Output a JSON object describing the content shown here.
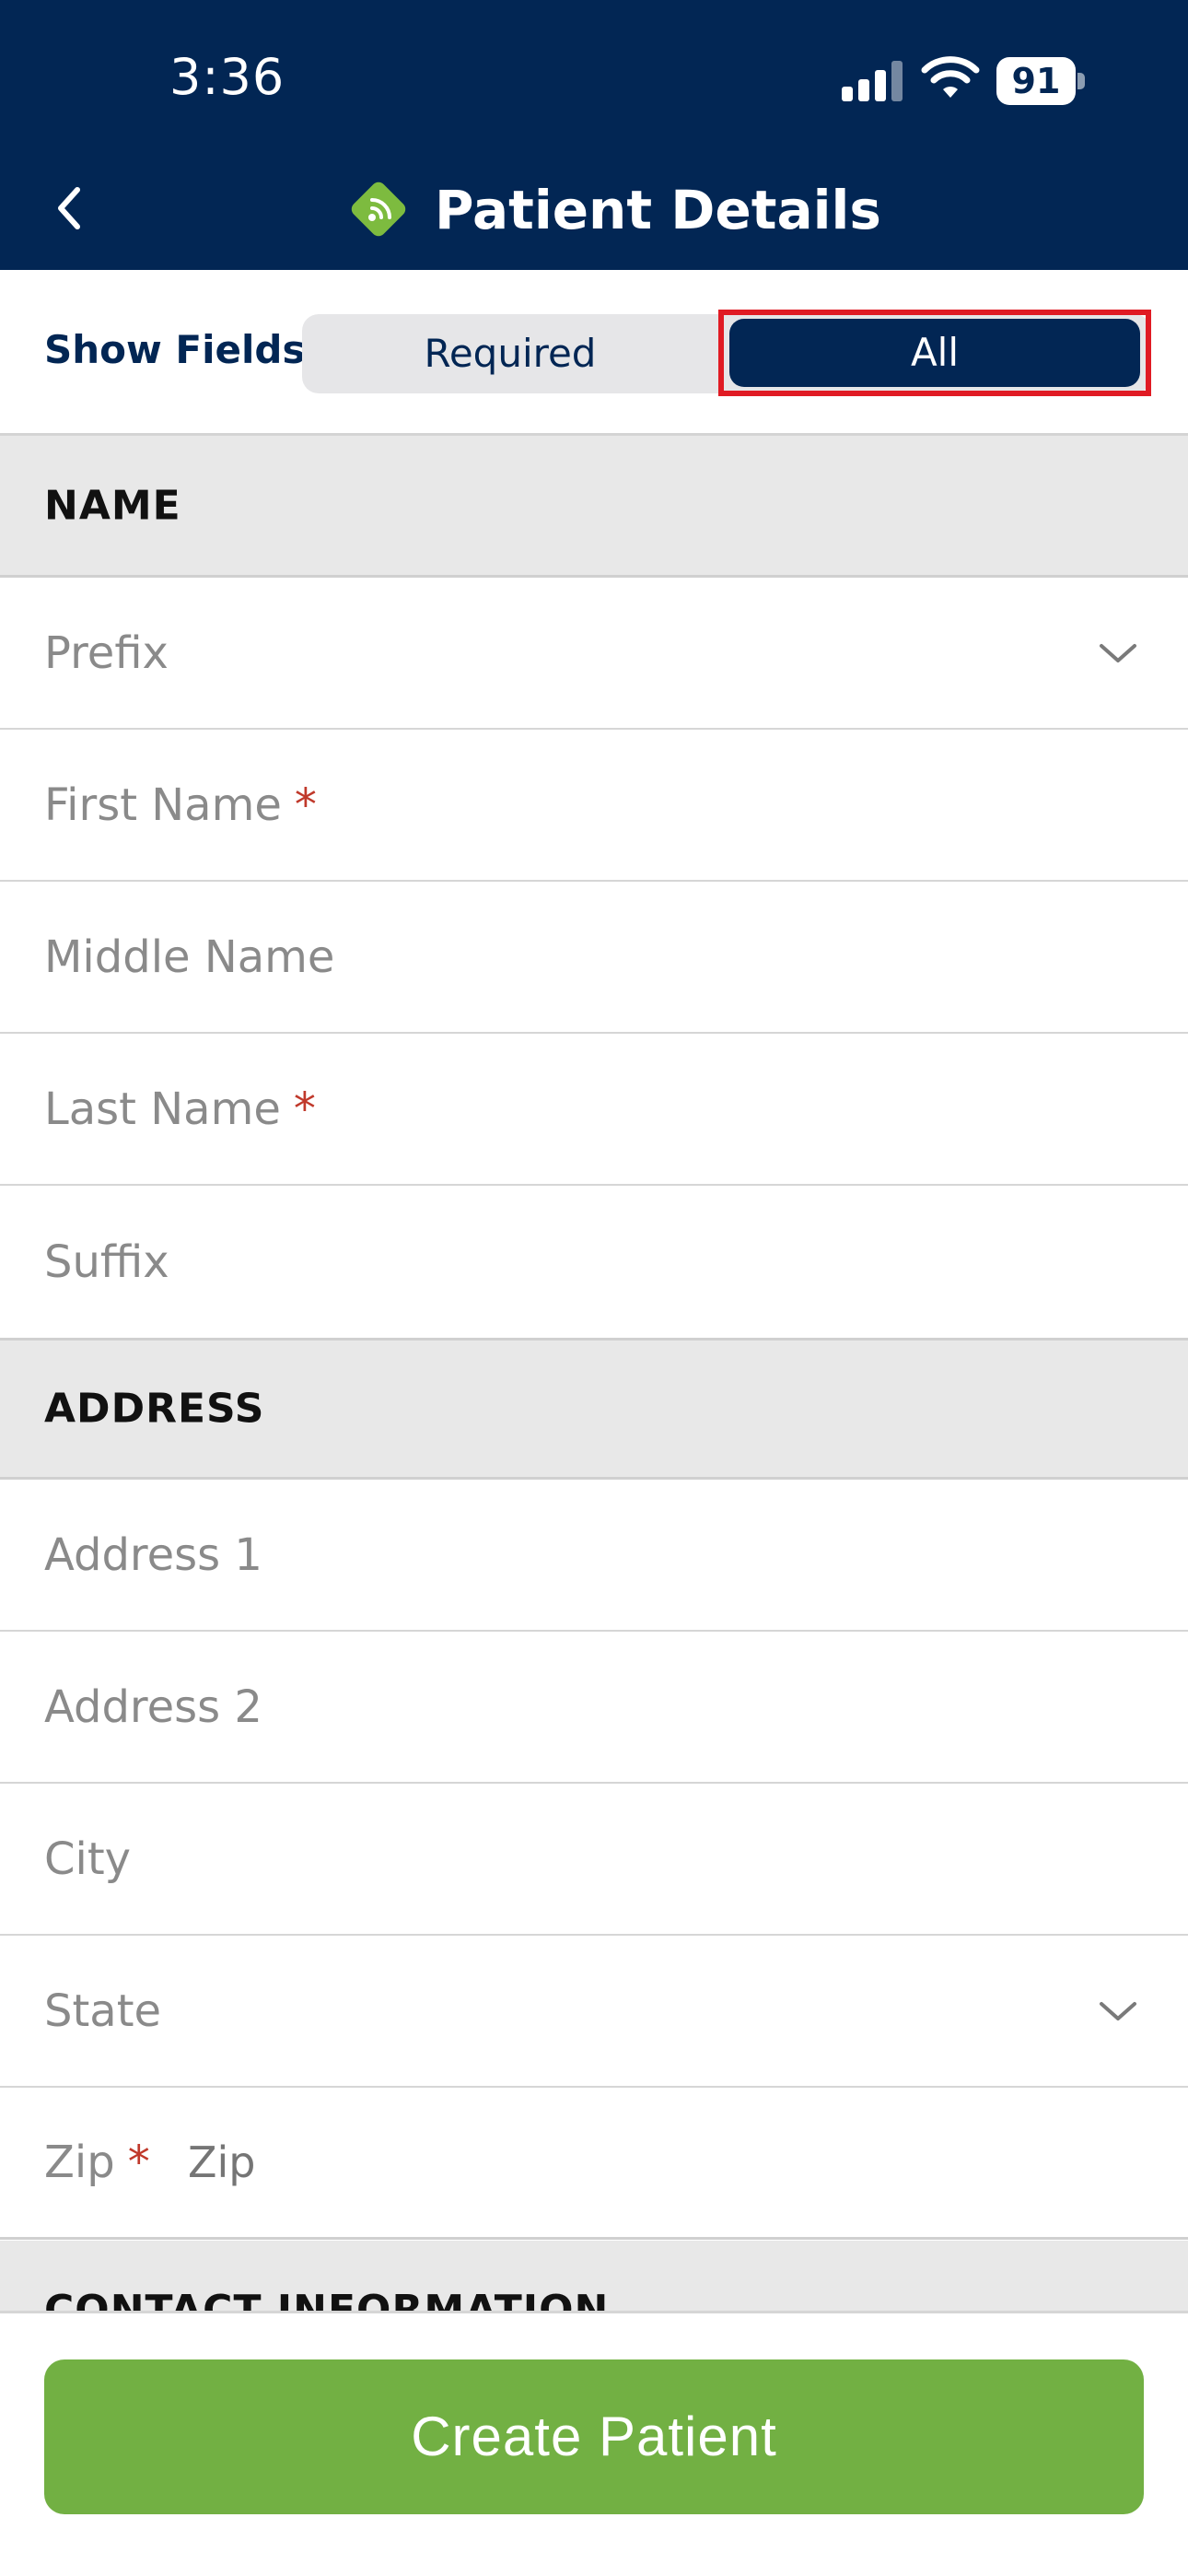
{
  "status_bar": {
    "time": "3:36",
    "battery": "91"
  },
  "header": {
    "title": "Patient Details"
  },
  "show_fields": {
    "label": "Show Fields:",
    "options": [
      "Required",
      "All"
    ],
    "selected": "All"
  },
  "sections": {
    "name": {
      "title": "NAME",
      "fields": {
        "prefix": "Prefix",
        "first_name": "First Name",
        "middle_name": "Middle Name",
        "last_name": "Last Name",
        "suffix": "Suffix"
      }
    },
    "address": {
      "title": "ADDRESS",
      "fields": {
        "address1": "Address 1",
        "address2": "Address 2",
        "city": "City",
        "state": "State",
        "zip": "Zip",
        "zip_placeholder": "Zip"
      }
    },
    "contact": {
      "title": "CONTACT INFORMATION"
    }
  },
  "required_marker": "*",
  "actions": {
    "create_patient": "Create Patient"
  },
  "colors": {
    "header_bg": "#022654",
    "accent_green": "#72b043",
    "required_red": "#c0392b",
    "highlight_red": "#e01b24"
  }
}
